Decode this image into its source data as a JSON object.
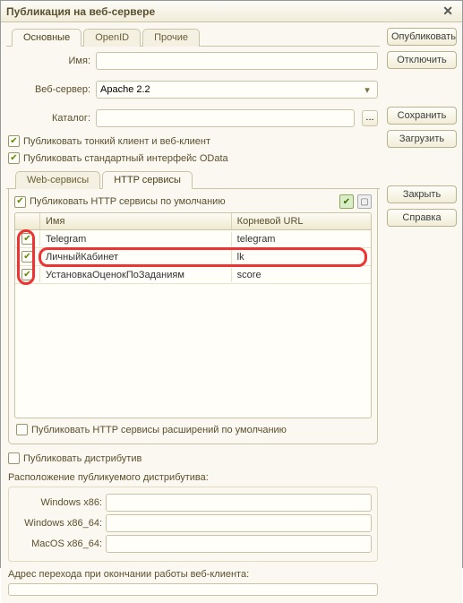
{
  "window": {
    "title": "Публикация на веб-сервере"
  },
  "buttons": {
    "publish": "Опубликовать",
    "disconnect": "Отключить",
    "save": "Сохранить",
    "load": "Загрузить",
    "close": "Закрыть",
    "help": "Справка"
  },
  "top_tabs": {
    "main": "Основные",
    "openid": "OpenID",
    "other": "Прочие",
    "active": "main"
  },
  "form": {
    "name_label": "Имя:",
    "name_value": "",
    "webserver_label": "Веб-сервер:",
    "webserver_value": "Apache 2.2",
    "catalog_label": "Каталог:",
    "catalog_value": "",
    "ellipsis": "..."
  },
  "checks": {
    "thin_client": "Публиковать тонкий клиент и веб-клиент",
    "odata": "Публиковать стандартный интерфейс OData",
    "http_default": "Публиковать HTTP сервисы по умолчанию",
    "http_ext_default": "Публиковать HTTP сервисы расширений по умолчанию",
    "publish_dist": "Публиковать дистрибутив"
  },
  "sub_tabs": {
    "ws": "Web-сервисы",
    "http": "HTTP сервисы",
    "active": "http"
  },
  "table": {
    "col_name": "Имя",
    "col_root": "Корневой URL",
    "rows": [
      {
        "checked": true,
        "name": "Telegram",
        "root": "telegram"
      },
      {
        "checked": true,
        "name": "ЛичныйКабинет",
        "root": "lk"
      },
      {
        "checked": true,
        "name": "УстановкаОценокПоЗаданиям",
        "root": "score"
      }
    ]
  },
  "distribution": {
    "location_label": "Расположение публикуемого дистрибутива:",
    "win_x86": "Windows x86:",
    "win_x86_64": "Windows x86_64:",
    "mac_x86_64": "MacOS x86_64:"
  },
  "footer": {
    "redirect_label": "Адрес перехода при окончании работы веб-клиента:"
  },
  "icons": {
    "check_all": "check-all-icon",
    "uncheck_all": "uncheck-all-icon"
  }
}
